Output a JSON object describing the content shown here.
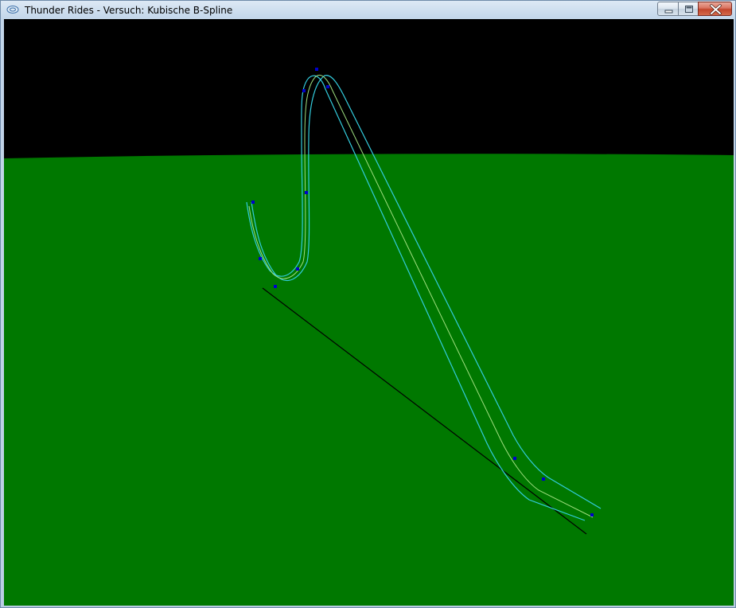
{
  "window": {
    "title": "Thunder Rides - Versuch: Kubische B-Spline",
    "icon": "opengl-app-icon",
    "controls": [
      "minimize-icon",
      "maximize-icon",
      "close-icon"
    ]
  },
  "scene": {
    "sky_color": "#000000",
    "ground_color": "#007800",
    "rail_color": "#33ccdd",
    "centerline_color": "#9fdf7f",
    "control_point_color": "#0000cc",
    "ground_line_color": "#000000"
  }
}
